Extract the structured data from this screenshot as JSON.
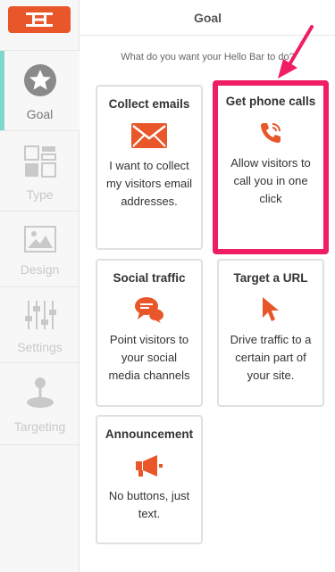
{
  "sidebar": {
    "logo_icon": "hello-bar-logo-icon",
    "items": [
      {
        "label": "Goal",
        "icon": "star-icon",
        "active": true
      },
      {
        "label": "Type",
        "icon": "layout-icon",
        "active": false
      },
      {
        "label": "Design",
        "icon": "image-icon",
        "active": false
      },
      {
        "label": "Settings",
        "icon": "sliders-icon",
        "active": false
      },
      {
        "label": "Targeting",
        "icon": "joystick-icon",
        "active": false
      }
    ]
  },
  "header": {
    "title": "Goal"
  },
  "question": "What do you want your Hello Bar to do?",
  "cards": [
    {
      "title": "Collect emails",
      "desc": "I want to collect my visitors email addresses.",
      "icon": "envelope-icon"
    },
    {
      "title": "Get phone calls",
      "desc": "Allow visitors to call you in one click",
      "icon": "phone-icon"
    },
    {
      "title": "Social traffic",
      "desc": "Point visitors to your social media channels",
      "icon": "chat-bubbles-icon"
    },
    {
      "title": "Target a URL",
      "desc": "Drive traffic to a certain part of your site.",
      "icon": "cursor-icon"
    },
    {
      "title": "Announcement",
      "desc": "No buttons, just text.",
      "icon": "megaphone-icon"
    }
  ],
  "colors": {
    "accent": "#e8562a",
    "highlight": "#ef1d63",
    "active_tab": "#7fd8c9"
  }
}
